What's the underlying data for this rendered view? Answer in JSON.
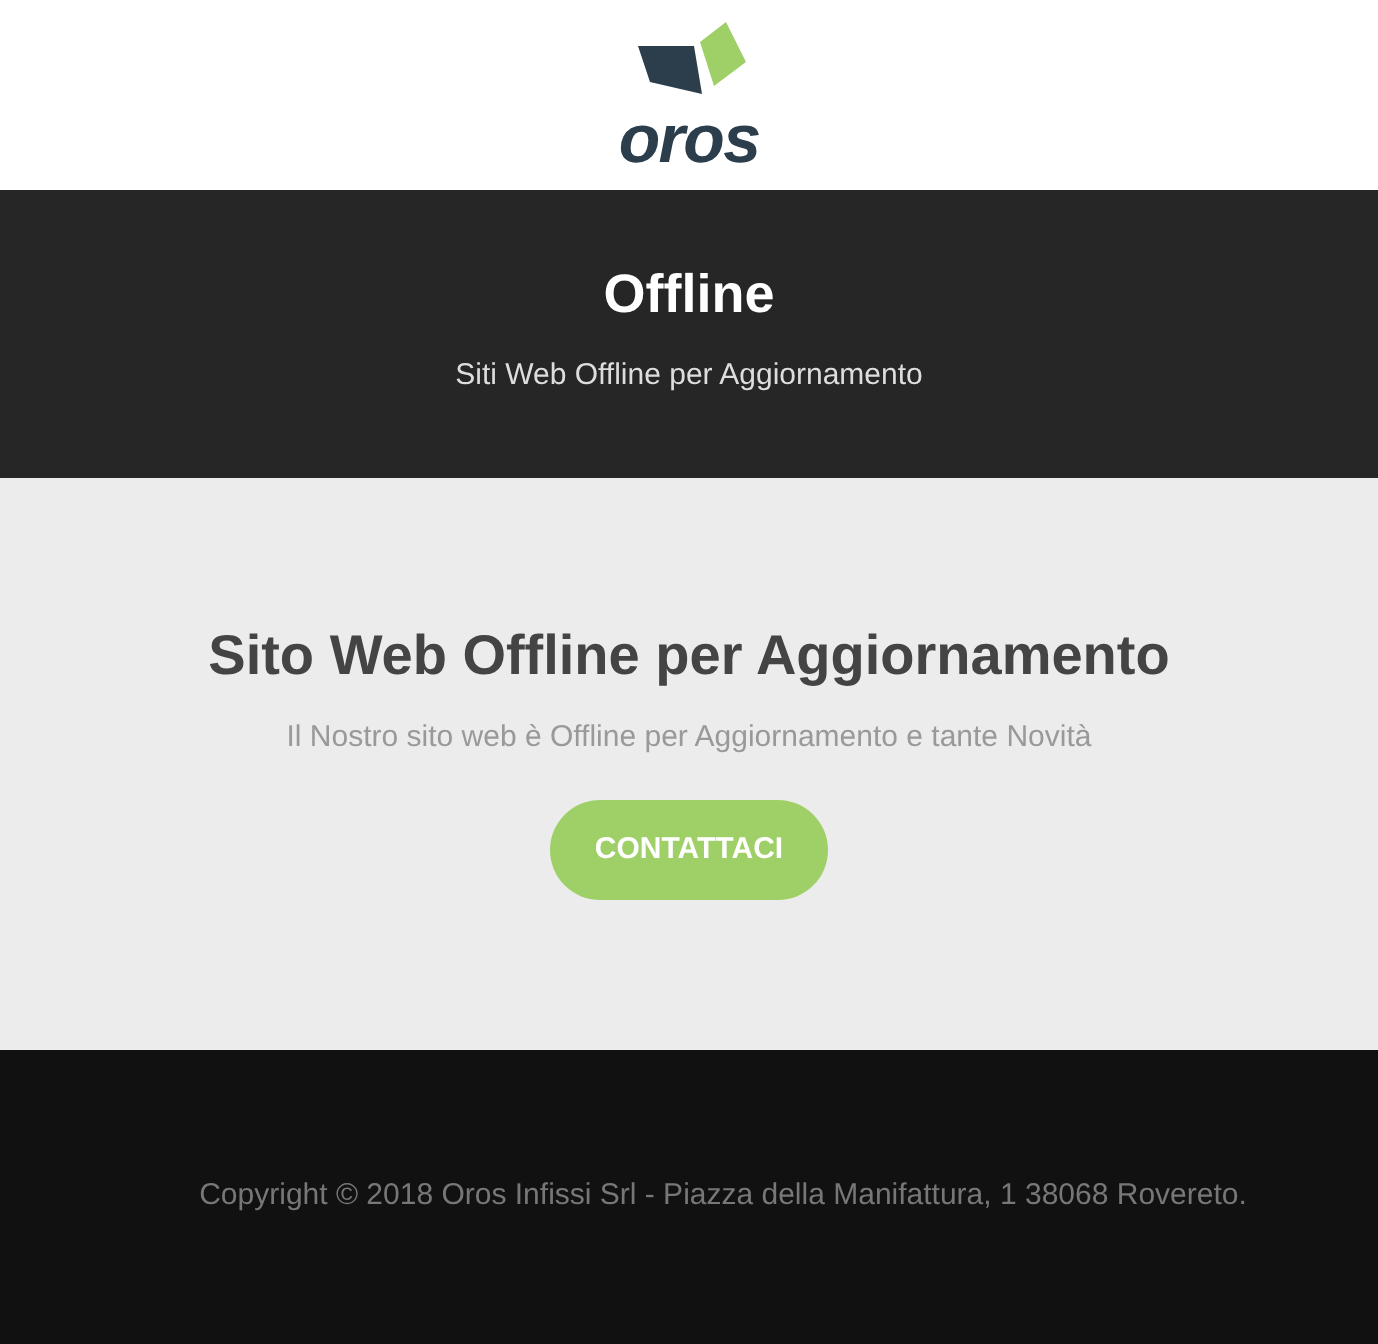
{
  "logo": {
    "text": "oros"
  },
  "hero": {
    "title": "Offline",
    "subtitle": "Siti Web Offline per Aggiornamento"
  },
  "main": {
    "heading": "Sito Web Offline per Aggiornamento",
    "text": "Il Nostro sito web è Offline per Aggiornamento e tante Novità",
    "button": "CONTATTACI"
  },
  "footer": {
    "copyright": "Copyright © 2018 Oros Infissi Srl - Piazza della Manifattura, 1 38068 Rovereto."
  }
}
